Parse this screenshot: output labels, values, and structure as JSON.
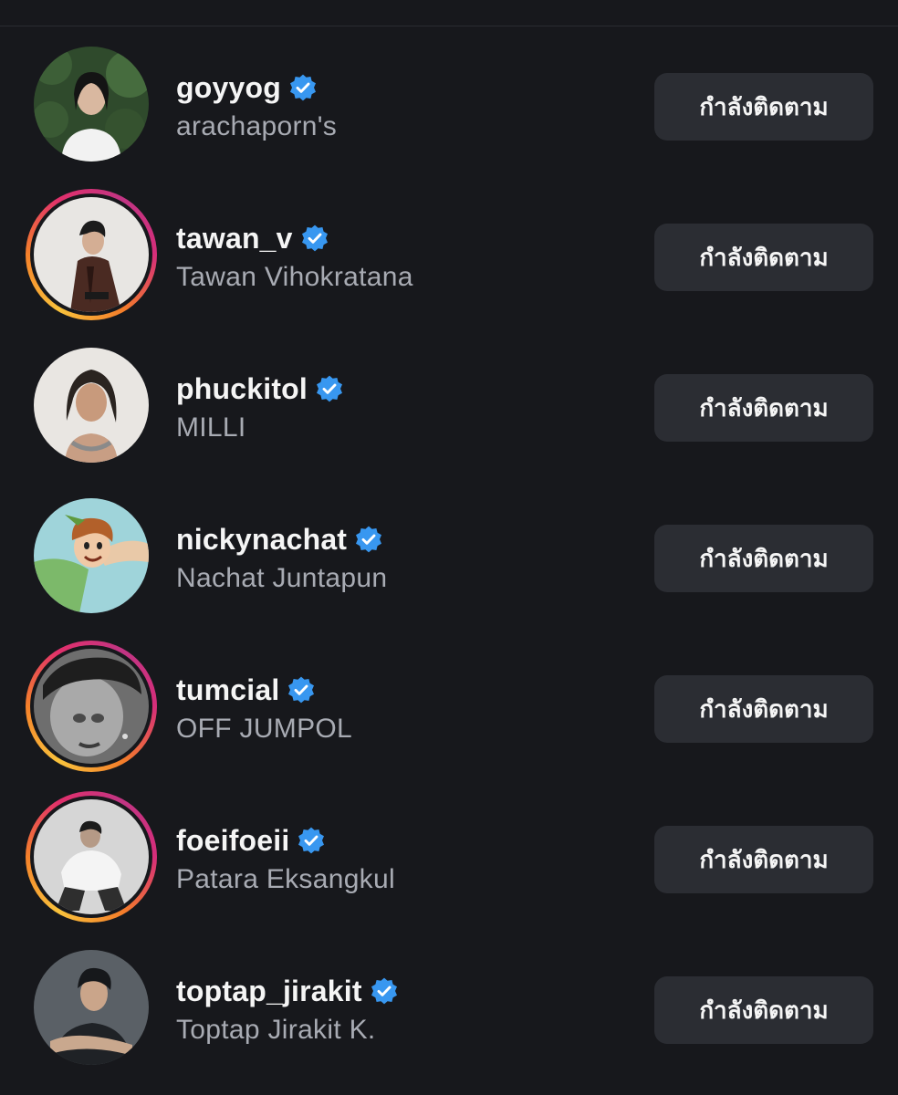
{
  "accounts": [
    {
      "username": "goyyog",
      "full_name": "arachaporn's",
      "verified": true,
      "story_ring": false,
      "button_label": "กำลังติดตาม"
    },
    {
      "username": "tawan_v",
      "full_name": "Tawan Vihokratana",
      "verified": true,
      "story_ring": true,
      "button_label": "กำลังติดตาม"
    },
    {
      "username": "phuckitol",
      "full_name": "MILLI",
      "verified": true,
      "story_ring": false,
      "button_label": "กำลังติดตาม"
    },
    {
      "username": "nickynachat",
      "full_name": "Nachat Juntapun",
      "verified": true,
      "story_ring": false,
      "button_label": "กำลังติดตาม"
    },
    {
      "username": "tumcial",
      "full_name": "OFF JUMPOL",
      "verified": true,
      "story_ring": true,
      "button_label": "กำลังติดตาม"
    },
    {
      "username": "foeifoeii",
      "full_name": "Patara Eksangkul",
      "verified": true,
      "story_ring": true,
      "button_label": "กำลังติดตาม"
    },
    {
      "username": "toptap_jirakit",
      "full_name": "Toptap Jirakit K.",
      "verified": true,
      "story_ring": false,
      "button_label": "กำลังติดตาม"
    }
  ],
  "colors": {
    "background": "#17181c",
    "button_bg": "#2b2d33",
    "verified_blue": "#3897f0",
    "secondary_text": "#a8abb3"
  },
  "icons": {
    "verified": "verified-badge-icon"
  }
}
